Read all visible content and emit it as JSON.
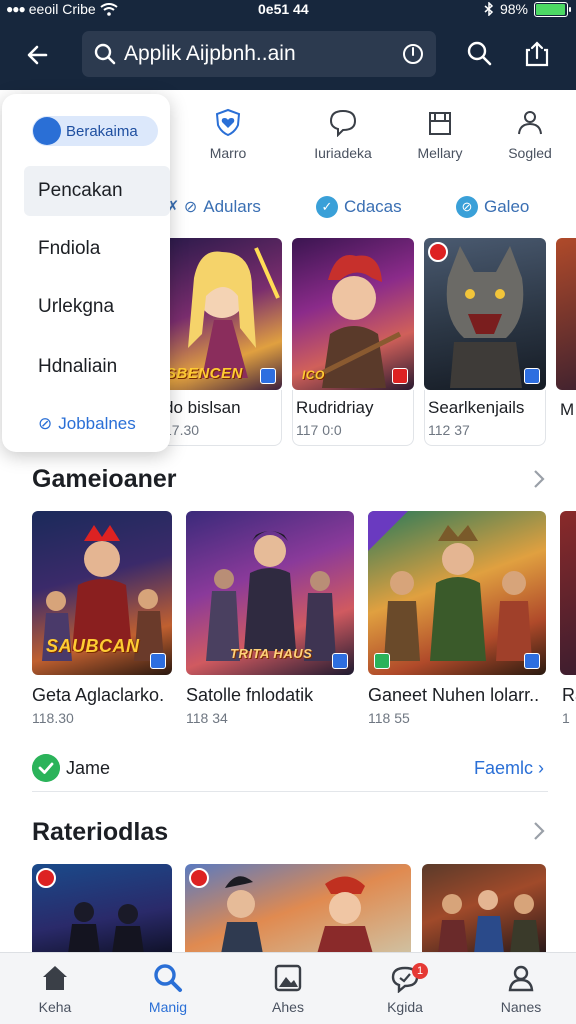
{
  "status_bar": {
    "carrier": "eeoil Cribe",
    "time": "0e51 44",
    "battery": "98%",
    "battery_level": 0.98
  },
  "header": {
    "search_value": "Applik Aijpbnh..ain",
    "icons": [
      "back-arrow-icon",
      "search-icon",
      "clear-icon",
      "share-icon"
    ]
  },
  "categories": [
    {
      "label": "Marro",
      "icon": "heart-shield-icon"
    },
    {
      "label": "Iuriadeka",
      "icon": "chat-bubble-icon"
    },
    {
      "label": "Mellary",
      "icon": "bag-icon"
    },
    {
      "label": "Sogled",
      "icon": "person-icon"
    }
  ],
  "chips": [
    {
      "label": "Adulars",
      "icon": "tag-icon"
    },
    {
      "label": "Cdacas",
      "icon": "check-circle-icon"
    },
    {
      "label": "Galeo",
      "icon": "badge-icon"
    }
  ],
  "dropdown": {
    "header": "Berakaima",
    "items": [
      "Pencakan",
      "Fndiola",
      "Urlekgna",
      "Hdnaliain"
    ],
    "link": "Jobbalnes"
  },
  "row1": [
    {
      "art_label": "SBENCEN",
      "title": "do bislsan",
      "meta": "17.30"
    },
    {
      "art_label": "",
      "title": "Rudridriay",
      "meta": "117 0:0"
    },
    {
      "art_label": "",
      "title": "Searlkenjails",
      "meta": "112 37"
    },
    {
      "art_label": "",
      "title": "M",
      "meta": ""
    }
  ],
  "section1": {
    "title": "Gameioaner"
  },
  "row2": [
    {
      "art_label": "SAUBCAN",
      "title": "Geta Aglaclarko.",
      "meta": "118.30"
    },
    {
      "art_label": "",
      "title": "Satolle fnlodatik",
      "meta": "118 34"
    },
    {
      "art_label": "",
      "title": "Ganeet Nuhen lolarr..",
      "meta": "118 55"
    },
    {
      "art_label": "",
      "title": "Ra",
      "meta": "1"
    }
  ],
  "game_row": {
    "label": "Jame",
    "link": "Faemlc"
  },
  "section2": {
    "title": "Rateriodlas"
  },
  "bottom_nav": [
    {
      "label": "Keha",
      "icon": "home-icon"
    },
    {
      "label": "Manig",
      "icon": "search-icon"
    },
    {
      "label": "Ahes",
      "icon": "image-icon"
    },
    {
      "label": "Kgida",
      "icon": "chat-icon",
      "badge": "1"
    },
    {
      "label": "Nanes",
      "icon": "profile-icon"
    }
  ],
  "colors": {
    "header_bg": "#17273d",
    "accent": "#2a6fd6",
    "success": "#2bb35a"
  }
}
